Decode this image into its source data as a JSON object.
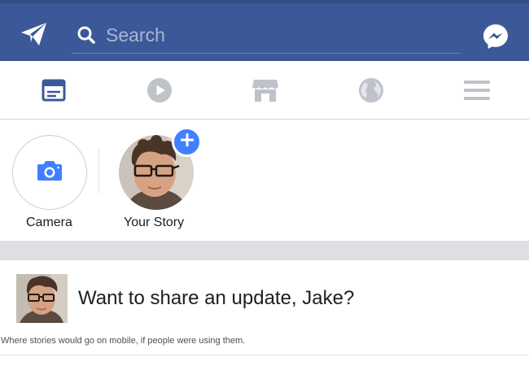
{
  "header": {
    "search_placeholder": "Search",
    "left_icon": "paper-plane-icon",
    "right_icon": "messenger-icon",
    "brand_color": "#3b5998"
  },
  "tabs": [
    {
      "icon": "news-feed-icon",
      "active": true
    },
    {
      "icon": "video-play-icon",
      "active": false
    },
    {
      "icon": "marketplace-icon",
      "active": false
    },
    {
      "icon": "globe-icon",
      "active": false
    },
    {
      "icon": "menu-icon",
      "active": false
    }
  ],
  "stories": {
    "camera_label": "Camera",
    "your_story_label": "Your Story",
    "accent_color": "#4080ff"
  },
  "composer": {
    "prompt": "Want to share an update, Jake?"
  },
  "caption": "Where stories would go on mobile, if people were using them."
}
